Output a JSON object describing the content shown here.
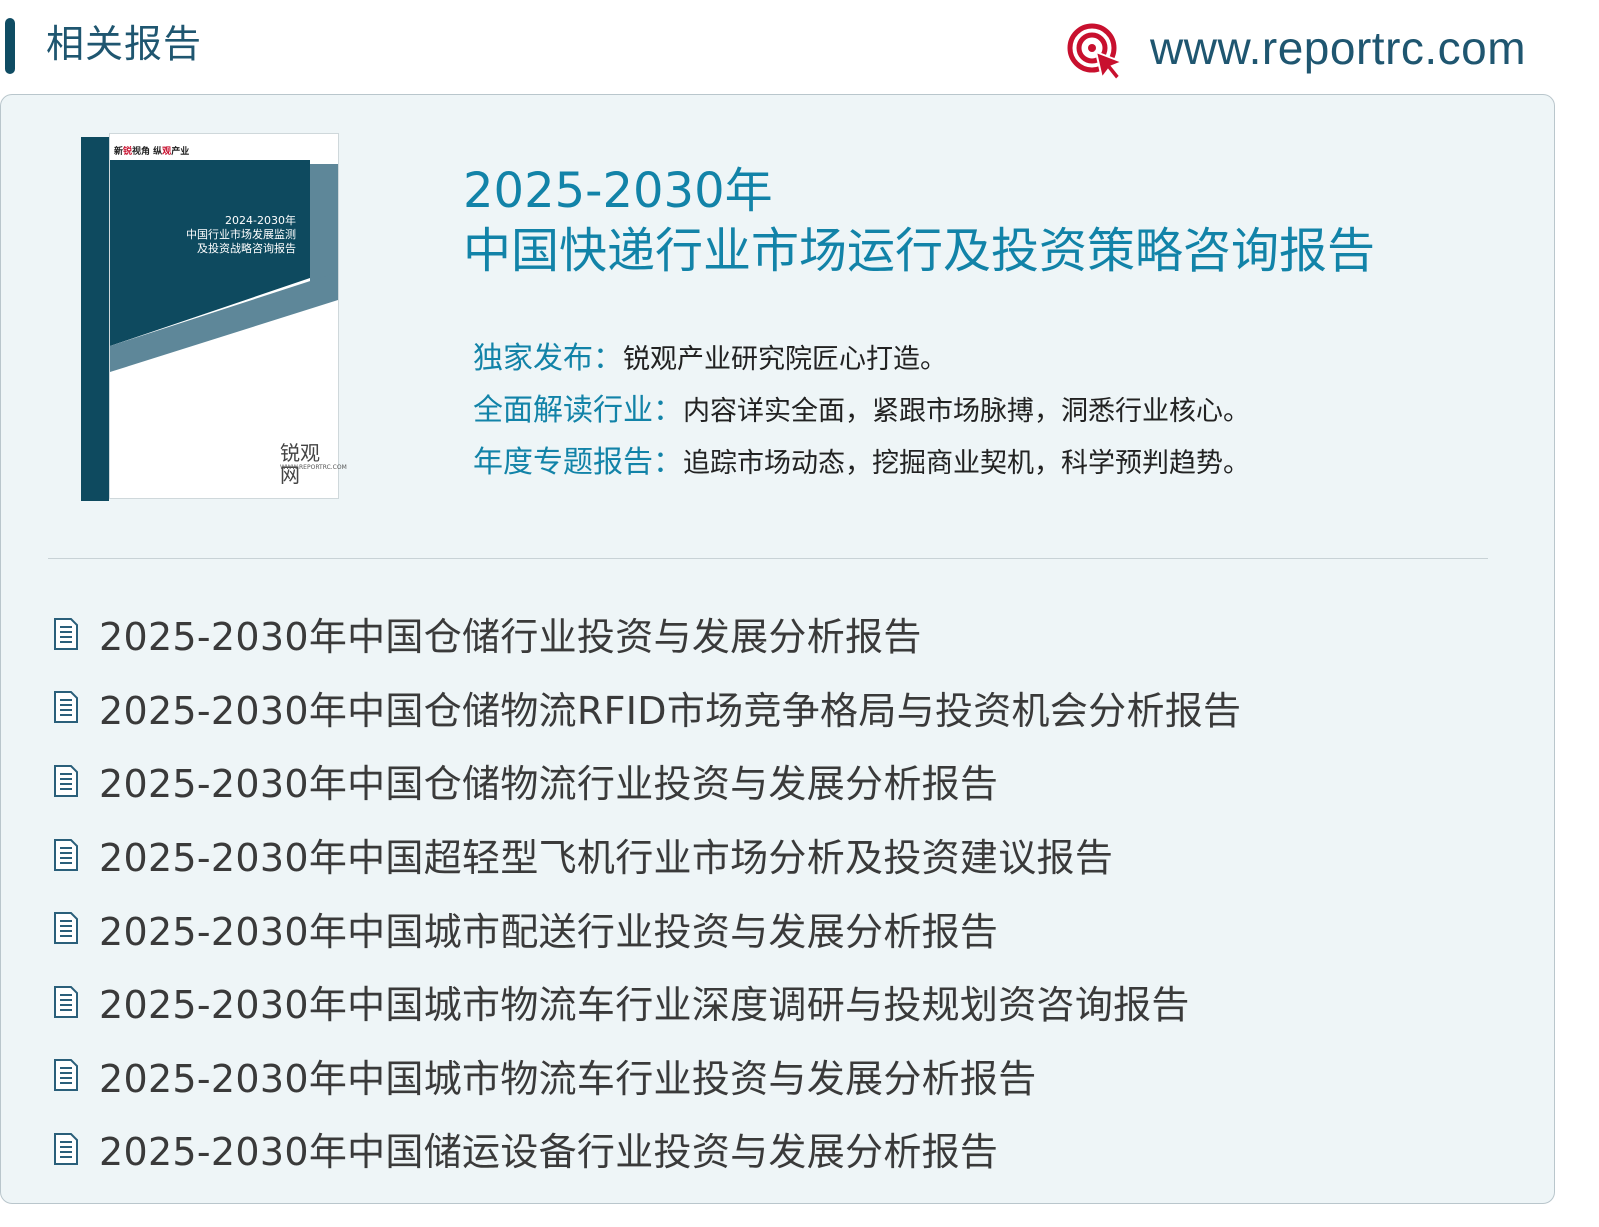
{
  "header": {
    "title": "相关报告",
    "url": "www.reportrc.com",
    "logo_icon": "target-cursor-icon",
    "accent_color": "#0f4c63",
    "logo_color": "#c8102e"
  },
  "cover": {
    "tag_part1": "新",
    "tag_red1": "锐",
    "tag_part2": "视角 纵",
    "tag_red2": "观",
    "tag_part3": "产业",
    "line1": "2024-2030年",
    "line2": "中国行业市场发展监测",
    "line3": "及投资战略咨询报告",
    "brand": "锐观网",
    "site": "WWW.REPORTRC.COM"
  },
  "report": {
    "title_line1": "2025-2030年",
    "title_line2": "中国快递行业市场运行及投资策略咨询报告",
    "features": [
      {
        "label": "独家发布：",
        "desc": "锐观产业研究院匠心打造。"
      },
      {
        "label": "全面解读行业：",
        "desc": "内容详实全面，紧跟市场脉搏，洞悉行业核心。"
      },
      {
        "label": "年度专题报告：",
        "desc": "追踪市场动态，挖掘商业契机，科学预判趋势。"
      }
    ],
    "title_color": "#1283a8"
  },
  "related": {
    "item_icon": "document-icon",
    "items": [
      "2025-2030年中国仓储行业投资与发展分析报告",
      "2025-2030年中国仓储物流RFID市场竞争格局与投资机会分析报告",
      "2025-2030年中国仓储物流行业投资与发展分析报告",
      "2025-2030年中国超轻型飞机行业市场分析及投资建议报告",
      "2025-2030年中国城市配送行业投资与发展分析报告",
      "2025-2030年中国城市物流车行业深度调研与投规划资咨询报告",
      "2025-2030年中国城市物流车行业投资与发展分析报告",
      "2025-2030年中国储运设备行业投资与发展分析报告"
    ]
  }
}
